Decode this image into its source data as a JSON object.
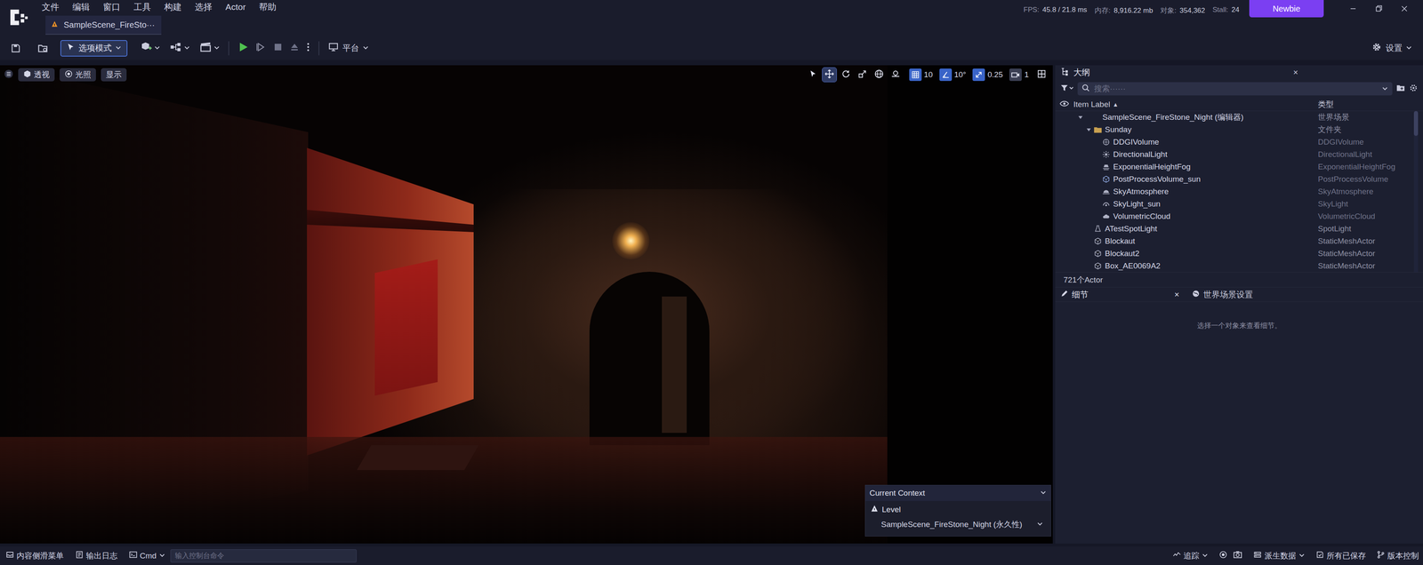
{
  "menu": [
    "文件",
    "编辑",
    "窗口",
    "工具",
    "构建",
    "选择",
    "Actor",
    "帮助"
  ],
  "stats": [
    {
      "label": "FPS:",
      "value": "45.8 / 21.8 ms"
    },
    {
      "label": "内存:",
      "value": "8,916.22 mb"
    },
    {
      "label": "对象:",
      "value": "354,362"
    },
    {
      "label": "Stall:",
      "value": "24"
    }
  ],
  "account": "Newbie",
  "document_tab": {
    "label": "SampleScene_FireSto···",
    "selected": true
  },
  "toolbar": {
    "mode": "选项模式",
    "platform": "平台",
    "settings": "设置"
  },
  "viewport": {
    "left_buttons": [
      "透视",
      "光照",
      "显示"
    ],
    "transform_tools": [
      {
        "kind": "select",
        "selected": false
      },
      {
        "kind": "move",
        "selected": true
      },
      {
        "kind": "rotate",
        "selected": false
      },
      {
        "kind": "scale",
        "selected": false
      }
    ],
    "snaps": [
      {
        "kind": "grid",
        "value": "10",
        "on": true
      },
      {
        "kind": "angle",
        "value": "10°",
        "on": true
      },
      {
        "kind": "scale",
        "value": "0.25",
        "on": true
      },
      {
        "kind": "camera",
        "value": "1",
        "on": false
      }
    ],
    "context": {
      "title": "Current Context",
      "level_label": "Level",
      "level": "SampleScene_FireStone_Night (永久性)"
    }
  },
  "outliner": {
    "tab": "大纲",
    "close": "×",
    "search_placeholder": "搜索······",
    "columns": [
      "Item Label",
      "类型"
    ],
    "sort": "▲",
    "rows": [
      {
        "label": "SampleScene_FireStone_Night (编辑器)",
        "type": "世界场景",
        "depth": 0,
        "kind": "none",
        "has_children": true,
        "expanded": true
      },
      {
        "label": "Sunday",
        "type": "文件夹",
        "depth": 1,
        "kind": "folder",
        "has_children": true,
        "expanded": true
      },
      {
        "label": "DDGIVolume",
        "type": "DDGIVolume",
        "depth": 2,
        "kind": "ddgi",
        "has_children": false,
        "expanded": false
      },
      {
        "label": "DirectionalLight",
        "type": "DirectionalLight",
        "depth": 2,
        "kind": "dirlight",
        "has_children": false,
        "expanded": false
      },
      {
        "label": "ExponentialHeightFog",
        "type": "ExponentialHeightFog",
        "depth": 2,
        "kind": "fog",
        "has_children": false,
        "expanded": false
      },
      {
        "label": "PostProcessVolume_sun",
        "type": "PostProcessVolume",
        "depth": 2,
        "kind": "postprocess",
        "has_children": false,
        "expanded": false
      },
      {
        "label": "SkyAtmosphere",
        "type": "SkyAtmosphere",
        "depth": 2,
        "kind": "sky",
        "has_children": false,
        "expanded": false
      },
      {
        "label": "SkyLight_sun",
        "type": "SkyLight",
        "depth": 2,
        "kind": "skylight",
        "has_children": false,
        "expanded": false
      },
      {
        "label": "VolumetricCloud",
        "type": "VolumetricCloud",
        "depth": 2,
        "kind": "cloud",
        "has_children": false,
        "expanded": false
      },
      {
        "label": "ATestSpotLight",
        "type": "SpotLight",
        "depth": 1,
        "kind": "spotlight",
        "has_children": false,
        "expanded": false
      },
      {
        "label": "Blockaut",
        "type": "StaticMeshActor",
        "depth": 1,
        "kind": "mesh",
        "has_children": false,
        "expanded": false
      },
      {
        "label": "Blockaut2",
        "type": "StaticMeshActor",
        "depth": 1,
        "kind": "mesh",
        "has_children": false,
        "expanded": false
      },
      {
        "label": "Box_AE0069A2",
        "type": "StaticMeshActor",
        "depth": 1,
        "kind": "mesh",
        "has_children": false,
        "expanded": false
      }
    ],
    "count": "721个Actor"
  },
  "details": {
    "tabs": [
      {
        "label": "细节",
        "selected": true,
        "close": "×"
      },
      {
        "label": "世界场景设置",
        "selected": false,
        "close": ""
      }
    ],
    "hint": "选择一个对象来查看细节。"
  },
  "status_bar": {
    "left": [
      "内容侧滑菜单",
      "输出日志"
    ],
    "cmd": "Cmd",
    "console_placeholder": "输入控制台命令",
    "right": [
      "追踪",
      "派生数据",
      "所有已保存",
      "版本控制"
    ]
  }
}
